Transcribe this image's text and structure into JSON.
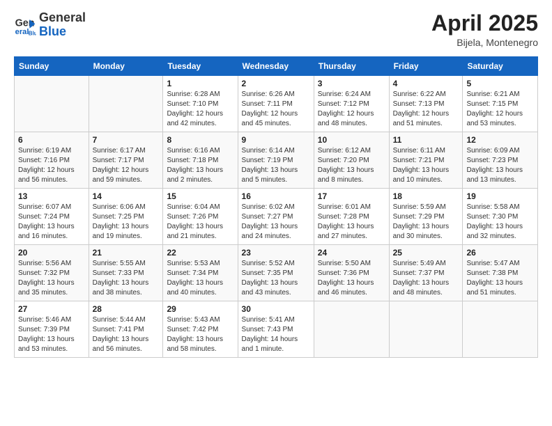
{
  "header": {
    "logo_general": "General",
    "logo_blue": "Blue",
    "title": "April 2025",
    "subtitle": "Bijela, Montenegro"
  },
  "weekdays": [
    "Sunday",
    "Monday",
    "Tuesday",
    "Wednesday",
    "Thursday",
    "Friday",
    "Saturday"
  ],
  "weeks": [
    {
      "days": [
        {
          "num": "",
          "info": ""
        },
        {
          "num": "",
          "info": ""
        },
        {
          "num": "1",
          "info": "Sunrise: 6:28 AM\nSunset: 7:10 PM\nDaylight: 12 hours and 42 minutes."
        },
        {
          "num": "2",
          "info": "Sunrise: 6:26 AM\nSunset: 7:11 PM\nDaylight: 12 hours and 45 minutes."
        },
        {
          "num": "3",
          "info": "Sunrise: 6:24 AM\nSunset: 7:12 PM\nDaylight: 12 hours and 48 minutes."
        },
        {
          "num": "4",
          "info": "Sunrise: 6:22 AM\nSunset: 7:13 PM\nDaylight: 12 hours and 51 minutes."
        },
        {
          "num": "5",
          "info": "Sunrise: 6:21 AM\nSunset: 7:15 PM\nDaylight: 12 hours and 53 minutes."
        }
      ]
    },
    {
      "days": [
        {
          "num": "6",
          "info": "Sunrise: 6:19 AM\nSunset: 7:16 PM\nDaylight: 12 hours and 56 minutes."
        },
        {
          "num": "7",
          "info": "Sunrise: 6:17 AM\nSunset: 7:17 PM\nDaylight: 12 hours and 59 minutes."
        },
        {
          "num": "8",
          "info": "Sunrise: 6:16 AM\nSunset: 7:18 PM\nDaylight: 13 hours and 2 minutes."
        },
        {
          "num": "9",
          "info": "Sunrise: 6:14 AM\nSunset: 7:19 PM\nDaylight: 13 hours and 5 minutes."
        },
        {
          "num": "10",
          "info": "Sunrise: 6:12 AM\nSunset: 7:20 PM\nDaylight: 13 hours and 8 minutes."
        },
        {
          "num": "11",
          "info": "Sunrise: 6:11 AM\nSunset: 7:21 PM\nDaylight: 13 hours and 10 minutes."
        },
        {
          "num": "12",
          "info": "Sunrise: 6:09 AM\nSunset: 7:23 PM\nDaylight: 13 hours and 13 minutes."
        }
      ]
    },
    {
      "days": [
        {
          "num": "13",
          "info": "Sunrise: 6:07 AM\nSunset: 7:24 PM\nDaylight: 13 hours and 16 minutes."
        },
        {
          "num": "14",
          "info": "Sunrise: 6:06 AM\nSunset: 7:25 PM\nDaylight: 13 hours and 19 minutes."
        },
        {
          "num": "15",
          "info": "Sunrise: 6:04 AM\nSunset: 7:26 PM\nDaylight: 13 hours and 21 minutes."
        },
        {
          "num": "16",
          "info": "Sunrise: 6:02 AM\nSunset: 7:27 PM\nDaylight: 13 hours and 24 minutes."
        },
        {
          "num": "17",
          "info": "Sunrise: 6:01 AM\nSunset: 7:28 PM\nDaylight: 13 hours and 27 minutes."
        },
        {
          "num": "18",
          "info": "Sunrise: 5:59 AM\nSunset: 7:29 PM\nDaylight: 13 hours and 30 minutes."
        },
        {
          "num": "19",
          "info": "Sunrise: 5:58 AM\nSunset: 7:30 PM\nDaylight: 13 hours and 32 minutes."
        }
      ]
    },
    {
      "days": [
        {
          "num": "20",
          "info": "Sunrise: 5:56 AM\nSunset: 7:32 PM\nDaylight: 13 hours and 35 minutes."
        },
        {
          "num": "21",
          "info": "Sunrise: 5:55 AM\nSunset: 7:33 PM\nDaylight: 13 hours and 38 minutes."
        },
        {
          "num": "22",
          "info": "Sunrise: 5:53 AM\nSunset: 7:34 PM\nDaylight: 13 hours and 40 minutes."
        },
        {
          "num": "23",
          "info": "Sunrise: 5:52 AM\nSunset: 7:35 PM\nDaylight: 13 hours and 43 minutes."
        },
        {
          "num": "24",
          "info": "Sunrise: 5:50 AM\nSunset: 7:36 PM\nDaylight: 13 hours and 46 minutes."
        },
        {
          "num": "25",
          "info": "Sunrise: 5:49 AM\nSunset: 7:37 PM\nDaylight: 13 hours and 48 minutes."
        },
        {
          "num": "26",
          "info": "Sunrise: 5:47 AM\nSunset: 7:38 PM\nDaylight: 13 hours and 51 minutes."
        }
      ]
    },
    {
      "days": [
        {
          "num": "27",
          "info": "Sunrise: 5:46 AM\nSunset: 7:39 PM\nDaylight: 13 hours and 53 minutes."
        },
        {
          "num": "28",
          "info": "Sunrise: 5:44 AM\nSunset: 7:41 PM\nDaylight: 13 hours and 56 minutes."
        },
        {
          "num": "29",
          "info": "Sunrise: 5:43 AM\nSunset: 7:42 PM\nDaylight: 13 hours and 58 minutes."
        },
        {
          "num": "30",
          "info": "Sunrise: 5:41 AM\nSunset: 7:43 PM\nDaylight: 14 hours and 1 minute."
        },
        {
          "num": "",
          "info": ""
        },
        {
          "num": "",
          "info": ""
        },
        {
          "num": "",
          "info": ""
        }
      ]
    }
  ]
}
